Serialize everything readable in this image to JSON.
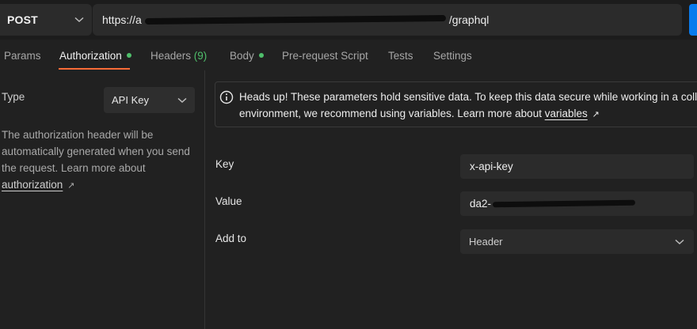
{
  "request": {
    "method": "POST",
    "url_prefix": "https://a",
    "url_suffix": "/graphql"
  },
  "tabs": [
    {
      "label": "Params"
    },
    {
      "label": "Authorization",
      "active": true,
      "indicator": "dot"
    },
    {
      "label": "Headers",
      "count": "(9)"
    },
    {
      "label": "Body",
      "indicator": "dot"
    },
    {
      "label": "Pre-request Script"
    },
    {
      "label": "Tests"
    },
    {
      "label": "Settings"
    }
  ],
  "auth": {
    "type_label": "Type",
    "type_value": "API Key",
    "help_text": "The authorization header will be automatically generated when you send the request. Learn more about",
    "help_link": "authorization",
    "notice_line1": "Heads up! These parameters hold sensitive data. To keep this data secure while working in a colla",
    "notice_line2": "environment, we recommend using variables. Learn more about",
    "notice_link": "variables",
    "key_label": "Key",
    "key_value": "x-api-key",
    "value_label": "Value",
    "value_prefix": "da2-",
    "addto_label": "Add to",
    "addto_value": "Header"
  },
  "colors": {
    "accent": "#ff6c37",
    "status_green": "#4fbf6b",
    "send_blue": "#097bed"
  },
  "icons": [
    "chevron-down-icon",
    "info-icon",
    "external-link-arrow-icon"
  ]
}
